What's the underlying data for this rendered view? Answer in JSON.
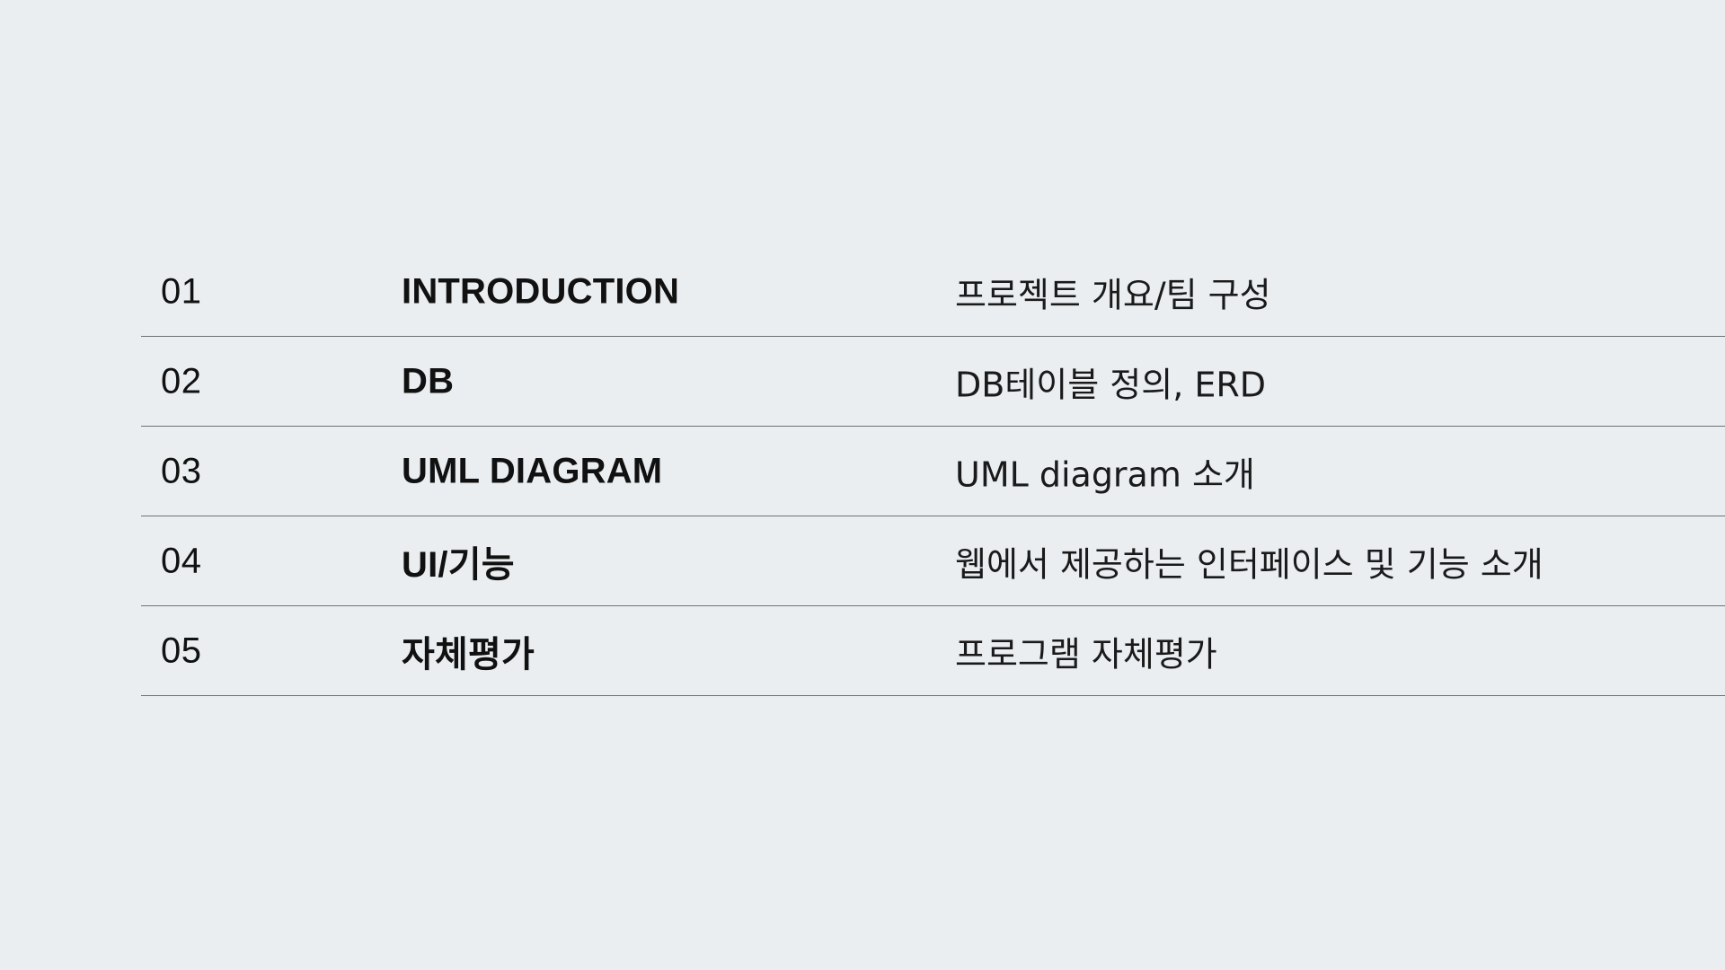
{
  "agenda": {
    "items": [
      {
        "number": "01",
        "title": "INTRODUCTION",
        "description": "프로젝트 개요/팀 구성"
      },
      {
        "number": "02",
        "title": "DB",
        "description": "DB테이블 정의, ERD"
      },
      {
        "number": "03",
        "title": "UML DIAGRAM",
        "description": "UML diagram 소개"
      },
      {
        "number": "04",
        "title": "UI/기능",
        "description": "웹에서 제공하는 인터페이스 및 기능 소개"
      },
      {
        "number": "05",
        "title": "자체평가",
        "description": "프로그램 자체평가"
      }
    ]
  },
  "colors": {
    "background": "#eaeef1",
    "text": "#111111",
    "divider": "#6f7275"
  }
}
